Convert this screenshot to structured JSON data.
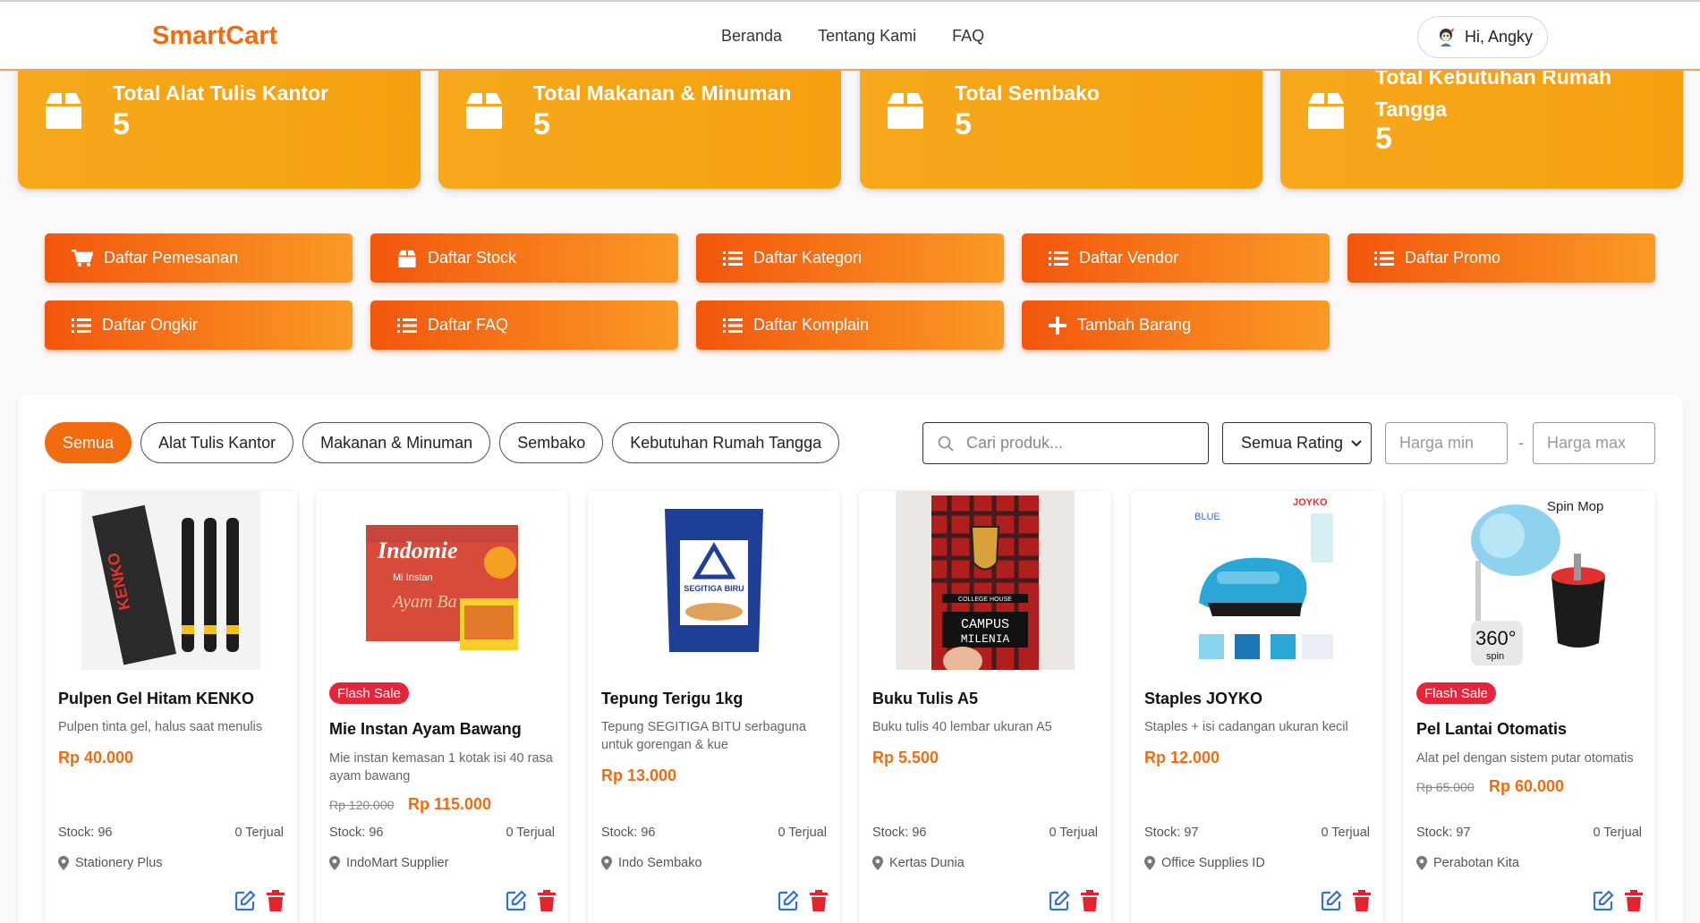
{
  "header": {
    "logo": "SmartCart",
    "nav": [
      "Beranda",
      "Tentang Kami",
      "FAQ"
    ],
    "user_greeting": "Hi, Angky"
  },
  "summary": [
    {
      "title": "Total Alat Tulis Kantor",
      "count": "5"
    },
    {
      "title": "Total Makanan & Minuman",
      "count": "5"
    },
    {
      "title": "Total Sembako",
      "count": "5"
    },
    {
      "title": "Total Kebutuhan Rumah Tangga",
      "count": "5"
    }
  ],
  "actions": [
    {
      "label": "Daftar Pemesanan",
      "icon": "cart-icon"
    },
    {
      "label": "Daftar Stock",
      "icon": "box-icon"
    },
    {
      "label": "Daftar Kategori",
      "icon": "list-icon"
    },
    {
      "label": "Daftar Vendor",
      "icon": "list-icon"
    },
    {
      "label": "Daftar Promo",
      "icon": "list-icon"
    },
    {
      "label": "Daftar Ongkir",
      "icon": "list-icon"
    },
    {
      "label": "Daftar FAQ",
      "icon": "list-icon"
    },
    {
      "label": "Daftar Komplain",
      "icon": "list-icon"
    },
    {
      "label": "Tambah Barang",
      "icon": "plus-icon"
    }
  ],
  "filters": {
    "chips": [
      "Semua",
      "Alat Tulis Kantor",
      "Makanan & Minuman",
      "Sembako",
      "Kebutuhan Rumah Tangga"
    ],
    "active_chip": "Semua",
    "search_placeholder": "Cari produk...",
    "rating_selected": "Semua Rating",
    "price_min_placeholder": "Harga min",
    "price_max_placeholder": "Harga max",
    "dash": "-"
  },
  "products": [
    {
      "name": "Pulpen Gel Hitam KENKO",
      "flash_sale": false,
      "desc": "Pulpen tinta gel, halus saat menulis",
      "old_price": "",
      "price": "Rp 40.000",
      "stock": "Stock: 96",
      "sold": "0 Terjual",
      "vendor": "Stationery Plus"
    },
    {
      "name": "Mie Instan Ayam Bawang",
      "flash_sale": true,
      "badge": "Flash Sale",
      "desc": "Mie instan kemasan 1 kotak isi 40 rasa ayam bawang",
      "old_price": "Rp 120.000",
      "price": "Rp 115.000",
      "stock": "Stock: 96",
      "sold": "0 Terjual",
      "vendor": "IndoMart Supplier"
    },
    {
      "name": "Tepung Terigu 1kg",
      "flash_sale": false,
      "desc": "Tepung SEGITIGA BITU serbaguna untuk gorengan & kue",
      "old_price": "",
      "price": "Rp 13.000",
      "stock": "Stock: 96",
      "sold": "0 Terjual",
      "vendor": "Indo Sembako"
    },
    {
      "name": "Buku Tulis A5",
      "flash_sale": false,
      "desc": "Buku tulis 40 lembar ukuran A5",
      "old_price": "",
      "price": "Rp 5.500",
      "stock": "Stock: 96",
      "sold": "0 Terjual",
      "vendor": "Kertas Dunia"
    },
    {
      "name": "Staples JOYKO",
      "flash_sale": false,
      "desc": "Staples + isi cadangan ukuran kecil",
      "old_price": "",
      "price": "Rp 12.000",
      "stock": "Stock: 97",
      "sold": "0 Terjual",
      "vendor": "Office Supplies ID"
    },
    {
      "name": "Pel Lantai Otomatis",
      "flash_sale": true,
      "badge": "Flash Sale",
      "desc": "Alat pel dengan sistem putar otomatis",
      "old_price": "Rp 65.000",
      "price": "Rp 60.000",
      "stock": "Stock: 97",
      "sold": "0 Terjual",
      "vendor": "Perabotan Kita"
    }
  ],
  "product_images": {
    "kenko_brand": "KENKO",
    "indomie_brand": "Indomie",
    "indomie_sub": "Mi Instan",
    "indomie_flavor": "Ayam Ba",
    "segitiga_brand": "SEGITIGA BIRU",
    "campus_line1": "CAMPUS",
    "campus_line2": "MILENIA",
    "campus_top": "COLLEGE HOUSE",
    "joyko_brand": "JOYKO",
    "joyko_color": "BLUE",
    "mop_title": "Spin Mop",
    "mop_360": "360°",
    "mop_spin": "spin"
  },
  "colors": {
    "accent": "#f26b0f",
    "summary": "#f7a81c",
    "flash": "#e9233a",
    "edit": "#2f6fe4",
    "delete": "#e4232f"
  }
}
